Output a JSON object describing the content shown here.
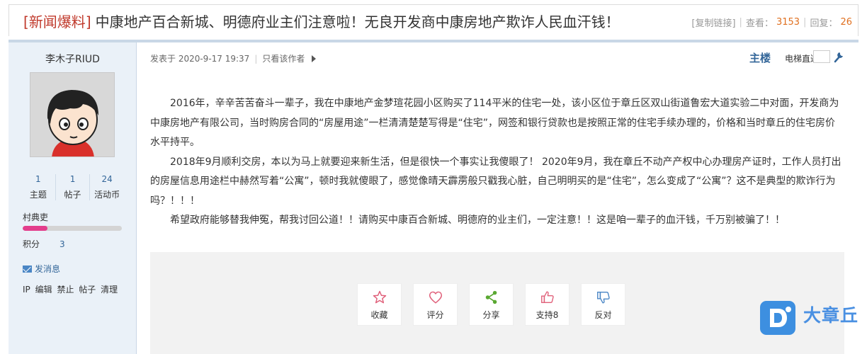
{
  "thread": {
    "category_bracket_open": "[",
    "category": "新闻爆料",
    "category_bracket_close": "]",
    "title": "中康地产百合新城、明德府业主们注意啦！无良开发商中康房地产欺诈人民血汗钱！",
    "copy_link": "[复制链接]",
    "views_label": "查看：",
    "views": "3153",
    "replies_label": "回复：",
    "replies": "26"
  },
  "author": {
    "name": "李木子RIUD",
    "stats": [
      {
        "value": "1",
        "label": "主题"
      },
      {
        "value": "1",
        "label": "帖子"
      },
      {
        "value": "24",
        "label": "活动币"
      }
    ],
    "group": "村典吏",
    "level_progress": 0.25,
    "level_color": "#e33e8c",
    "score_label": "积分",
    "score": "3",
    "send_message": "发消息",
    "admin_links": [
      "IP",
      "编辑",
      "禁止",
      "帖子",
      "清理"
    ]
  },
  "post": {
    "posted_at": "发表于 2020-9-17 19:37",
    "only_author": "只看该作者",
    "floor": "主楼",
    "elevator": "电梯直达",
    "paragraphs": [
      "2016年，辛辛苦苦奋斗一辈子，我在中康地产金梦瑄花园小区购买了114平米的住宅一处，该小区位于章丘区双山街道鲁宏大道实验二中对面，开发商为中康房地产有限公司，当时购房合同的“房屋用途”一栏清清楚楚写得是“住宅”，网签和银行贷款也是按照正常的住宅手续办理的，价格和当时章丘的住宅房价水平持平。",
      "2018年9月顺利交房，本以为马上就要迎来新生活，但是很快一个事实让我傻眼了！ 2020年9月，我在章丘不动产产权中心办理房产证时，工作人员打出的房屋信息用途栏中赫然写着“公寓”，顿时我就傻眼了，感觉像晴天霹雳般只戳我心脏，自己明明买的是“住宅”，怎么变成了“公寓”？这不是典型的欺诈行为吗？！！！",
      "希望政府能够替我伸冤，帮我讨回公道！！请购买中康百合新城、明德府的业主们，一定注意！！这是咱一辈子的血汗钱，千万别被骗了！！"
    ],
    "actions": [
      {
        "label": "收藏",
        "icon": "star-icon"
      },
      {
        "label": "评分",
        "icon": "heart-icon"
      },
      {
        "label": "分享",
        "icon": "share-icon"
      },
      {
        "label": "支持",
        "count": "8",
        "icon": "thumbs-up-icon"
      },
      {
        "label": "反对",
        "icon": "thumbs-down-icon"
      }
    ]
  },
  "site": {
    "brand": "大章丘",
    "accent": "#336699",
    "title_category_color": "#c0392b",
    "count_color": "#e07020"
  }
}
